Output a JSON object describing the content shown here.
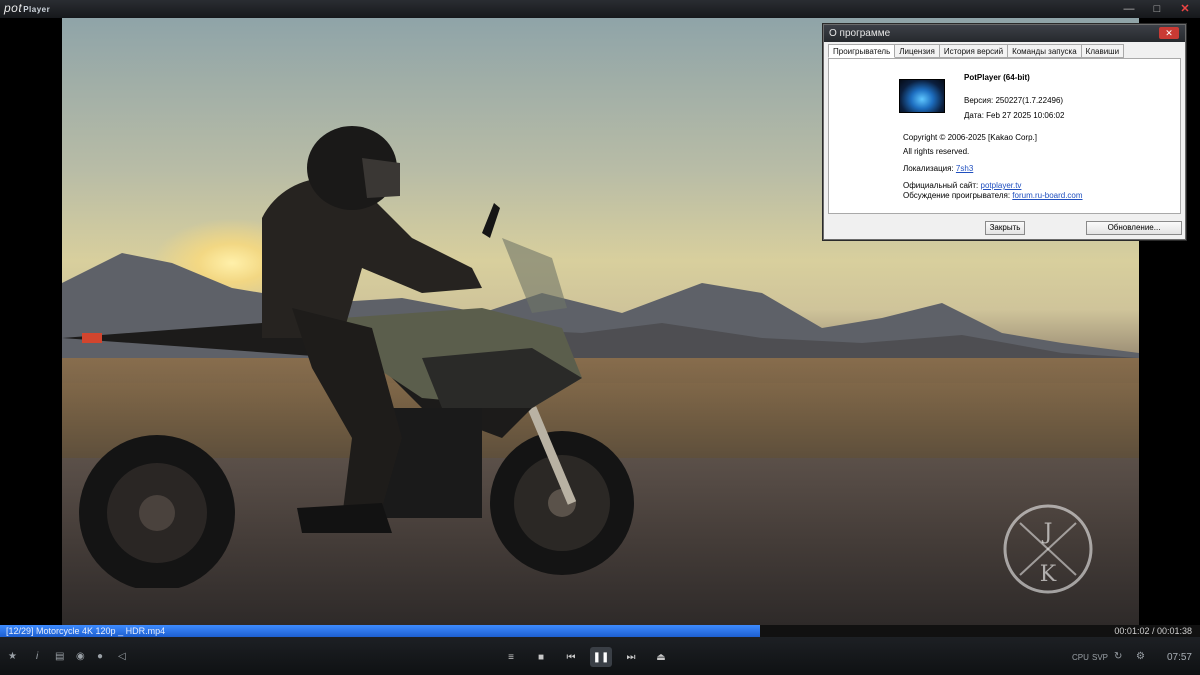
{
  "app": {
    "logo_main": "pot",
    "logo_small": "Player"
  },
  "window_buttons": [
    "min-icon",
    "max-icon",
    "close-icon"
  ],
  "dialog": {
    "title": "О программе",
    "tabs": [
      "Проигрыватель",
      "Лицензия",
      "История версий",
      "Команды запуска",
      "Клавиши"
    ],
    "app_name": "PotPlayer (64-bit)",
    "version": "Версия: 250227(1.7.22496)",
    "date": "Дата: Feb 27 2025 10:06:02",
    "copyright": "Copyright © 2006-2025 [Kakao Corp.]",
    "rights": "All rights reserved.",
    "localization_label": "Локализация:",
    "localization_link": "7sh3",
    "site_label": "Официальный сайт:",
    "site_link": "potplayer.tv",
    "forum_label": "Обсуждение проигрывателя:",
    "forum_link": "forum.ru-board.com",
    "close_button": "Закрыть",
    "update_button": "Обновление..."
  },
  "playback": {
    "filename": "[12/29] Motorcycle 4K 120p _ HDR.mp4",
    "time": "00:01:02 / 00:01:38",
    "progress": 0.633,
    "clock": "07:57",
    "labels": {
      "cpu": "CPU",
      "svp": "SVP"
    }
  },
  "watermark": {
    "top": "J",
    "bottom": "K"
  },
  "colors": {
    "accent": "#2a74e8",
    "link": "#1f4fbf"
  }
}
